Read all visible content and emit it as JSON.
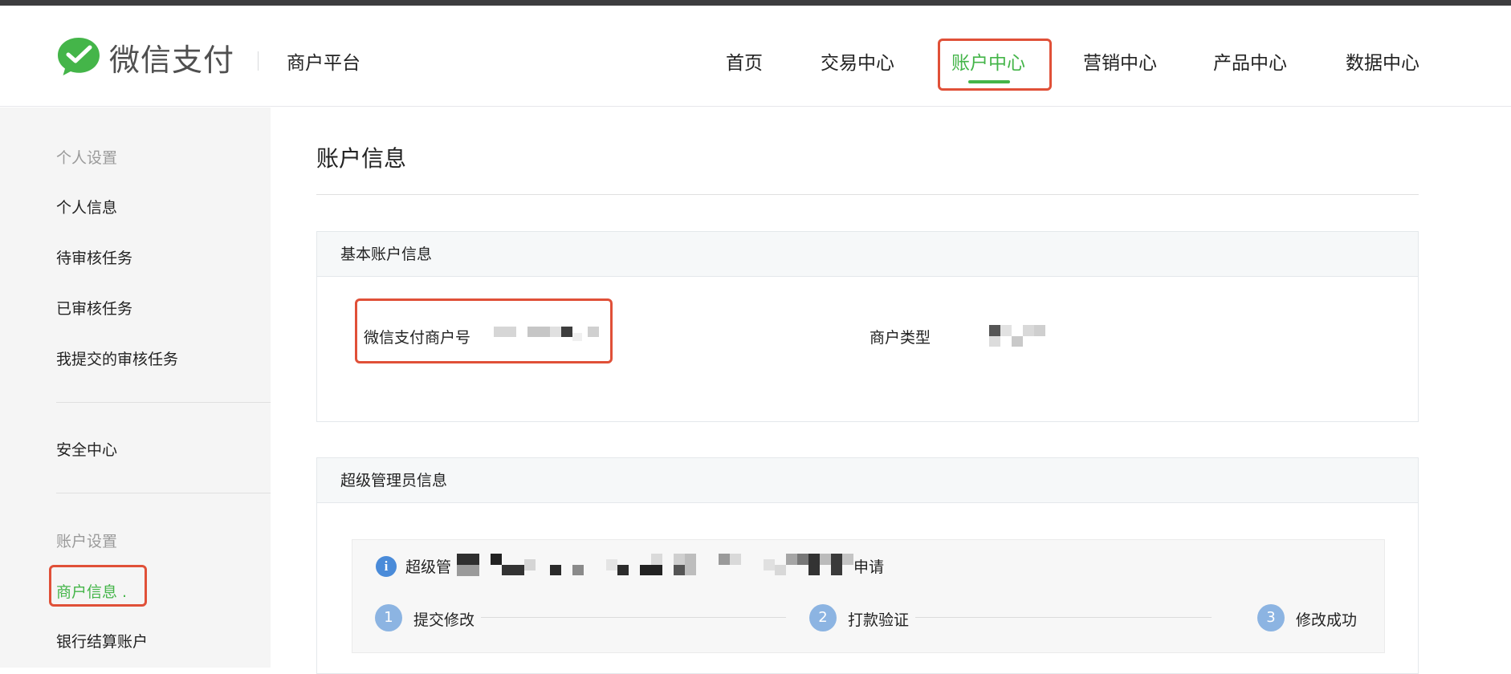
{
  "header": {
    "brand": "微信支付",
    "platform": "商户平台",
    "nav": [
      {
        "label": "首页"
      },
      {
        "label": "交易中心"
      },
      {
        "label": "账户中心"
      },
      {
        "label": "营销中心"
      },
      {
        "label": "产品中心"
      },
      {
        "label": "数据中心"
      }
    ],
    "active_nav": "账户中心"
  },
  "sidebar": {
    "groups": [
      {
        "title": "个人设置",
        "items": [
          "个人信息",
          "待审核任务",
          "已审核任务",
          "我提交的审核任务"
        ]
      },
      {
        "title": "",
        "items": [
          "安全中心"
        ]
      },
      {
        "title": "账户设置",
        "items": [
          "商户信息 .",
          "银行结算账户"
        ]
      }
    ],
    "active_item": "商户信息 ."
  },
  "main": {
    "title": "账户信息",
    "basic_panel": {
      "heading": "基本账户信息",
      "merchant_id_label": "微信支付商户号",
      "merchant_type_label": "商户类型"
    },
    "admin_panel": {
      "heading": "超级管理员信息",
      "notice_prefix": "超级管",
      "notice_suffix": "申请",
      "steps": [
        {
          "num": "1",
          "label": "提交修改"
        },
        {
          "num": "2",
          "label": "打款验证"
        },
        {
          "num": "3",
          "label": "修改成功"
        }
      ]
    }
  },
  "colors": {
    "accent_green": "#44b549",
    "highlight_red": "#e05038",
    "step_blue": "#8cb4e2",
    "info_blue": "#4a8bd9"
  }
}
